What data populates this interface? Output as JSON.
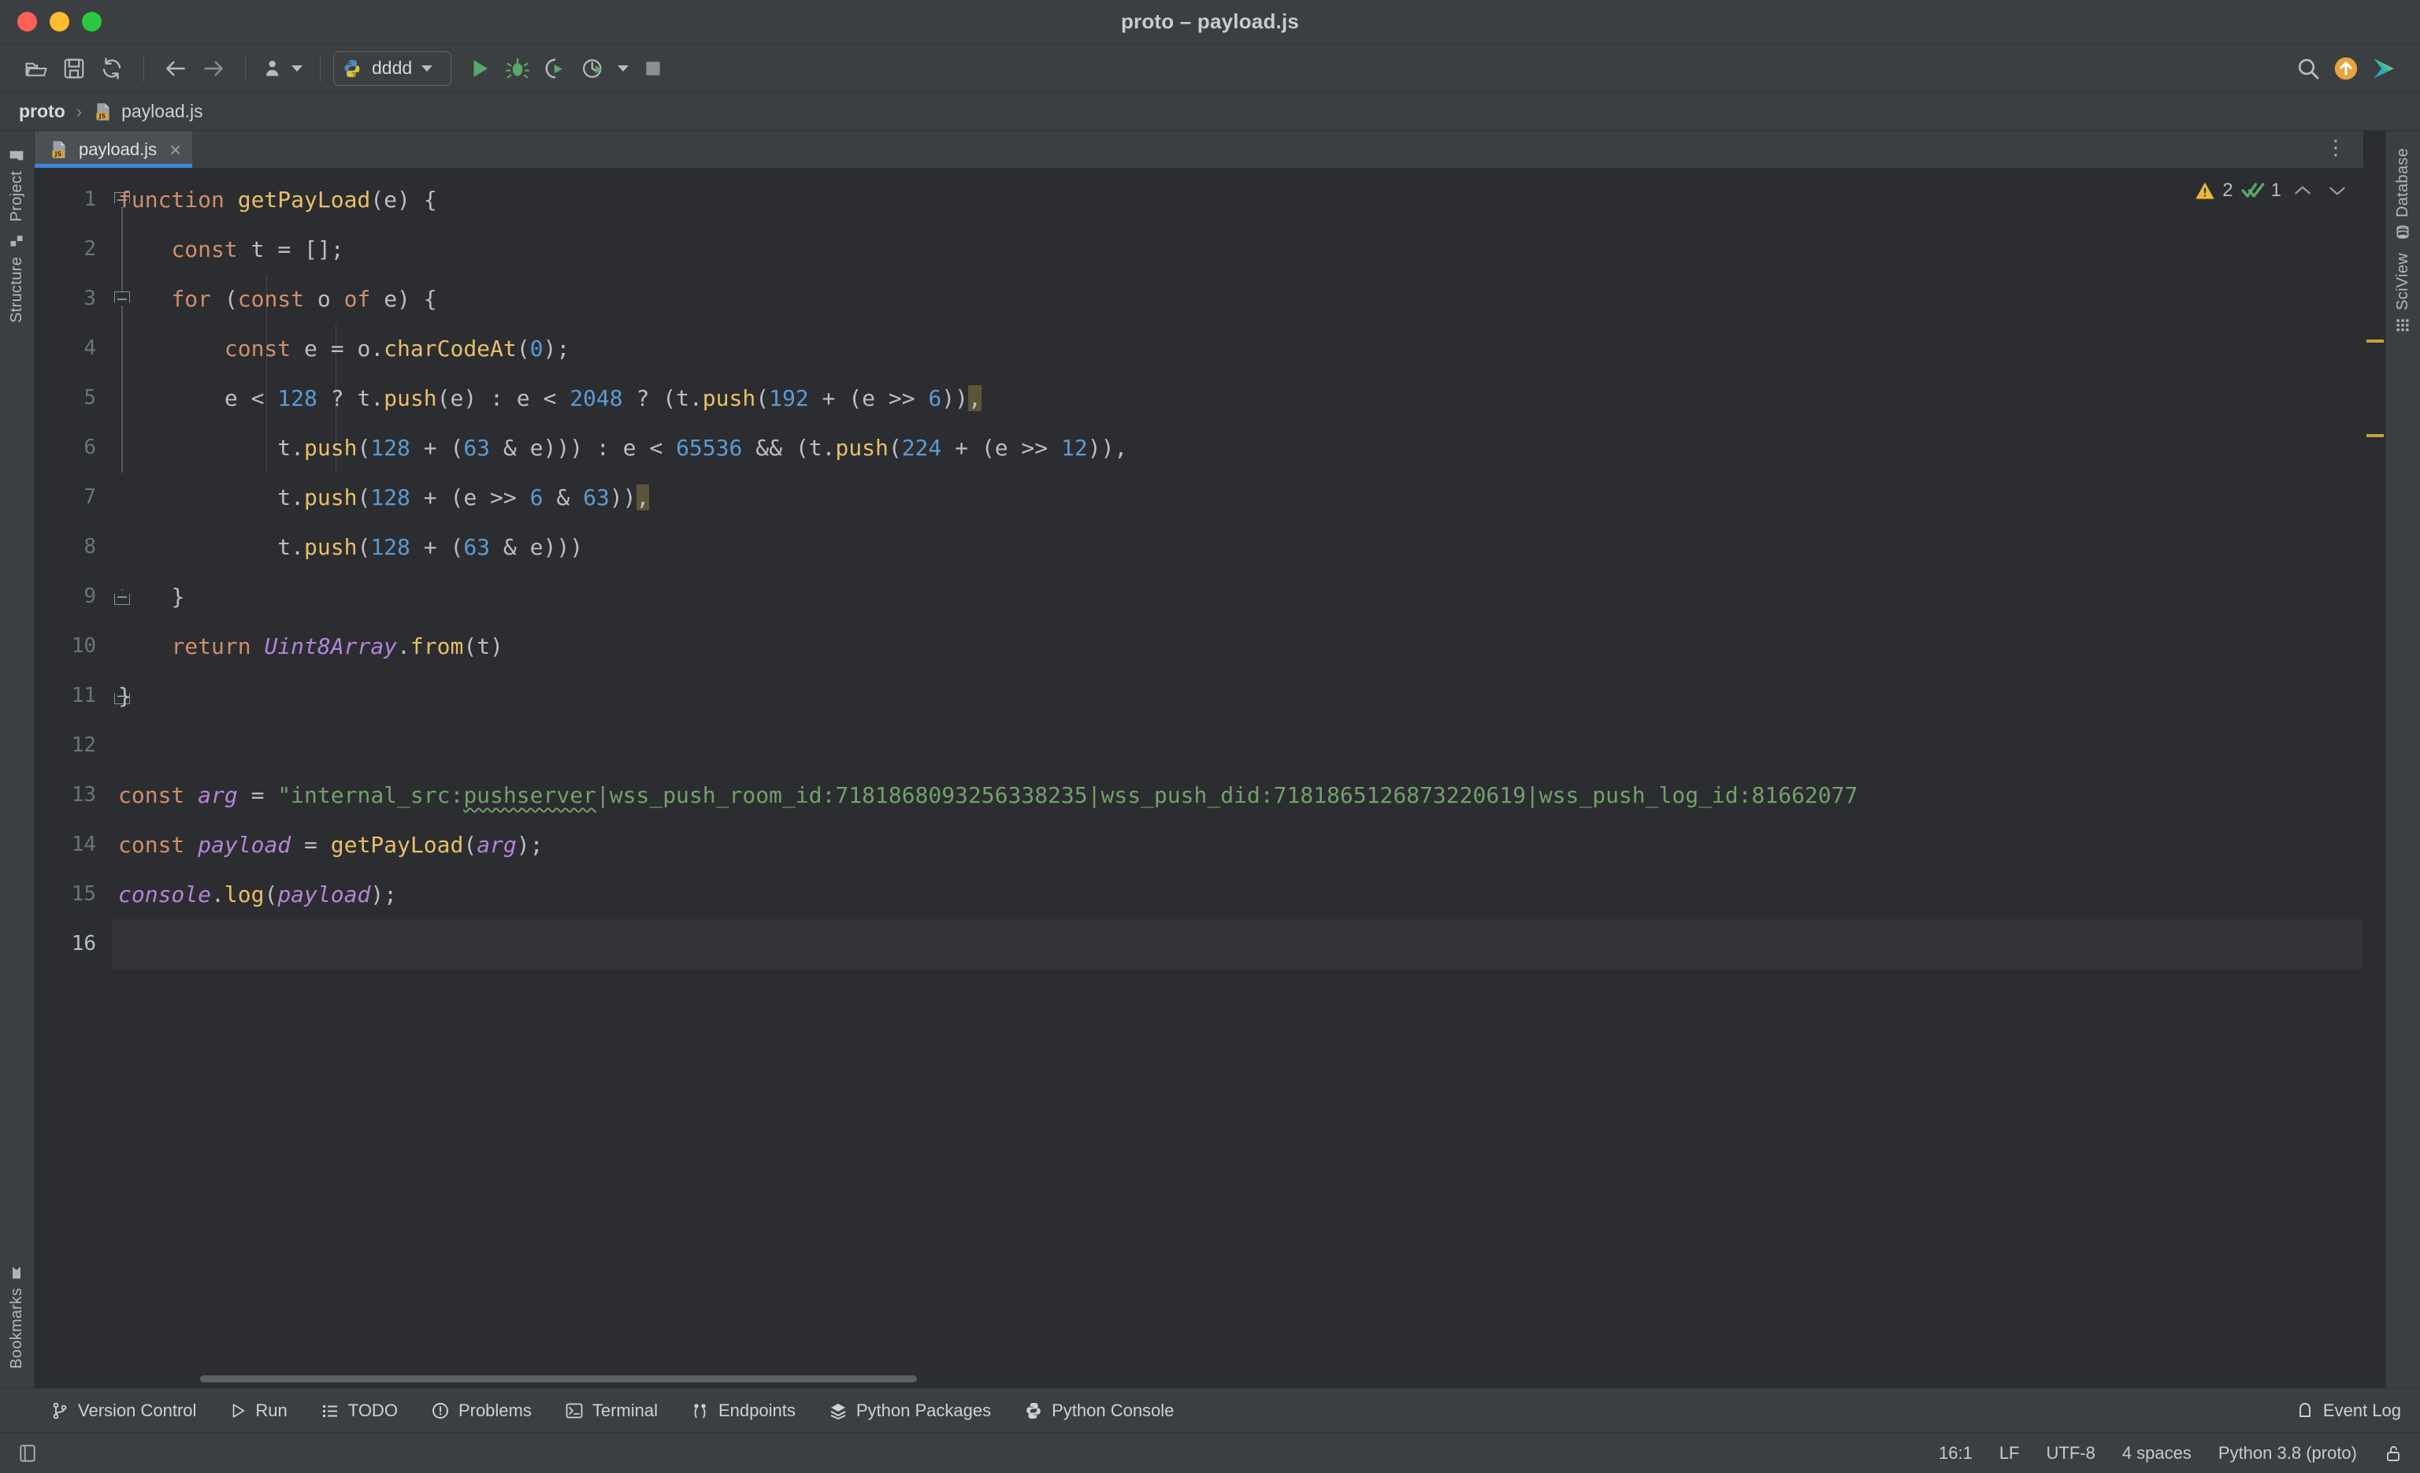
{
  "window": {
    "title": "proto – payload.js",
    "traffic_lights": [
      "close",
      "minimize",
      "maximize"
    ]
  },
  "toolbar": {
    "icons": [
      {
        "name": "open-folder-icon",
        "label": "Open"
      },
      {
        "name": "save-icon",
        "label": "Save All"
      },
      {
        "name": "sync-icon",
        "label": "Reload from Disk"
      },
      {
        "name": "back-arrow-icon",
        "label": "Back"
      },
      {
        "name": "forward-arrow-icon",
        "label": "Forward"
      },
      {
        "name": "user-icon",
        "label": "Account"
      }
    ],
    "run_config": {
      "name": "dddd",
      "icon": "python-icon"
    },
    "actions": [
      {
        "name": "run-icon",
        "label": "Run"
      },
      {
        "name": "debug-icon",
        "label": "Debug"
      },
      {
        "name": "run-with-coverage-icon",
        "label": "Run with Coverage"
      },
      {
        "name": "profile-icon",
        "label": "Profile"
      },
      {
        "name": "stop-icon",
        "label": "Stop"
      }
    ],
    "right_icons": [
      {
        "name": "search-icon",
        "label": "Search Everywhere"
      },
      {
        "name": "update-icon",
        "label": "Update"
      },
      {
        "name": "app-logo-icon",
        "label": "IDE Services"
      }
    ]
  },
  "breadcrumb": {
    "root": "proto",
    "separator": "›",
    "file": "payload.js",
    "file_icon": "js-file-icon"
  },
  "tabs": {
    "active": "payload.js",
    "items": [
      {
        "label": "payload.js",
        "icon": "js-file-icon",
        "close": "×",
        "active": true
      }
    ],
    "more": "⋮"
  },
  "left_sidebar": {
    "items": [
      {
        "label": "Project",
        "icon": "folder-icon"
      },
      {
        "label": "Structure",
        "icon": "structure-icon"
      },
      {
        "label": "Bookmarks",
        "icon": "bookmark-icon"
      }
    ]
  },
  "right_sidebar": {
    "items": [
      {
        "label": "Database",
        "icon": "database-icon"
      },
      {
        "label": "SciView",
        "icon": "grid-icon"
      }
    ]
  },
  "inspections": {
    "warning_icon": "warning-triangle-icon",
    "warning_count": "2",
    "ok_icon": "double-check-icon",
    "ok_count": "1",
    "prev": "⌃",
    "next": "⌄"
  },
  "editor": {
    "line_numbers": [
      "1",
      "2",
      "3",
      "4",
      "5",
      "6",
      "7",
      "8",
      "9",
      "10",
      "11",
      "12",
      "13",
      "14",
      "15",
      "16"
    ],
    "current_line": 16,
    "lines": [
      {
        "n": "1",
        "text": "function getPayLoad(e) {"
      },
      {
        "n": "2",
        "text": "    const t = [];"
      },
      {
        "n": "3",
        "text": "    for (const o of e) {"
      },
      {
        "n": "4",
        "text": "        const e = o.charCodeAt(0);"
      },
      {
        "n": "5",
        "text": "        e < 128 ? t.push(e) : e < 2048 ? (t.push(192 + (e >> 6)),"
      },
      {
        "n": "6",
        "text": "            t.push(128 + (63 & e))) : e < 65536 && (t.push(224 + (e >> 12)),"
      },
      {
        "n": "7",
        "text": "            t.push(128 + (e >> 6 & 63)),"
      },
      {
        "n": "8",
        "text": "            t.push(128 + (63 & e)))"
      },
      {
        "n": "9",
        "text": "    }"
      },
      {
        "n": "10",
        "text": "    return Uint8Array.from(t)"
      },
      {
        "n": "11",
        "text": "}"
      },
      {
        "n": "12",
        "text": ""
      },
      {
        "n": "13",
        "text": "const arg = \"internal_src:pushserver|wss_push_room_id:7181868093256338235|wss_push_did:7181865126873220619|wss_push_log_id:81662077"
      },
      {
        "n": "14",
        "text": "const payload = getPayLoad(arg);"
      },
      {
        "n": "15",
        "text": "console.log(payload);"
      },
      {
        "n": "16",
        "text": ""
      }
    ],
    "string_value": "internal_src:pushserver|wss_push_room_id:7181868093256338235|wss_push_did:7181865126873220619|wss_push_log_id:81662077",
    "typo_word": "pushserver",
    "colors": {
      "background": "#2b2d30",
      "keyword": "#cf8e6d",
      "function": "#e8bf6a",
      "number": "#5c9ad1",
      "string": "#73a06b",
      "class": "#b584d6",
      "variable": "#b584d6",
      "punctuation": "#bcbec4",
      "current_line": "#323438",
      "brace_match": "#5b5438"
    }
  },
  "tool_windows": {
    "items": [
      {
        "label": "Version Control",
        "icon": "branch-icon"
      },
      {
        "label": "Run",
        "icon": "run-icon"
      },
      {
        "label": "TODO",
        "icon": "list-icon"
      },
      {
        "label": "Problems",
        "icon": "problems-icon"
      },
      {
        "label": "Terminal",
        "icon": "terminal-icon"
      },
      {
        "label": "Endpoints",
        "icon": "endpoints-icon"
      },
      {
        "label": "Python Packages",
        "icon": "packages-icon"
      },
      {
        "label": "Python Console",
        "icon": "python-icon"
      }
    ],
    "event_log": {
      "label": "Event Log",
      "icon": "bell-icon"
    }
  },
  "status_bar": {
    "caret": "16:1",
    "line_separator": "LF",
    "encoding": "UTF-8",
    "indent": "4 spaces",
    "interpreter": "Python 3.8 (proto)",
    "lock_icon": "unlock-icon",
    "left_icon": "layout-icon"
  }
}
